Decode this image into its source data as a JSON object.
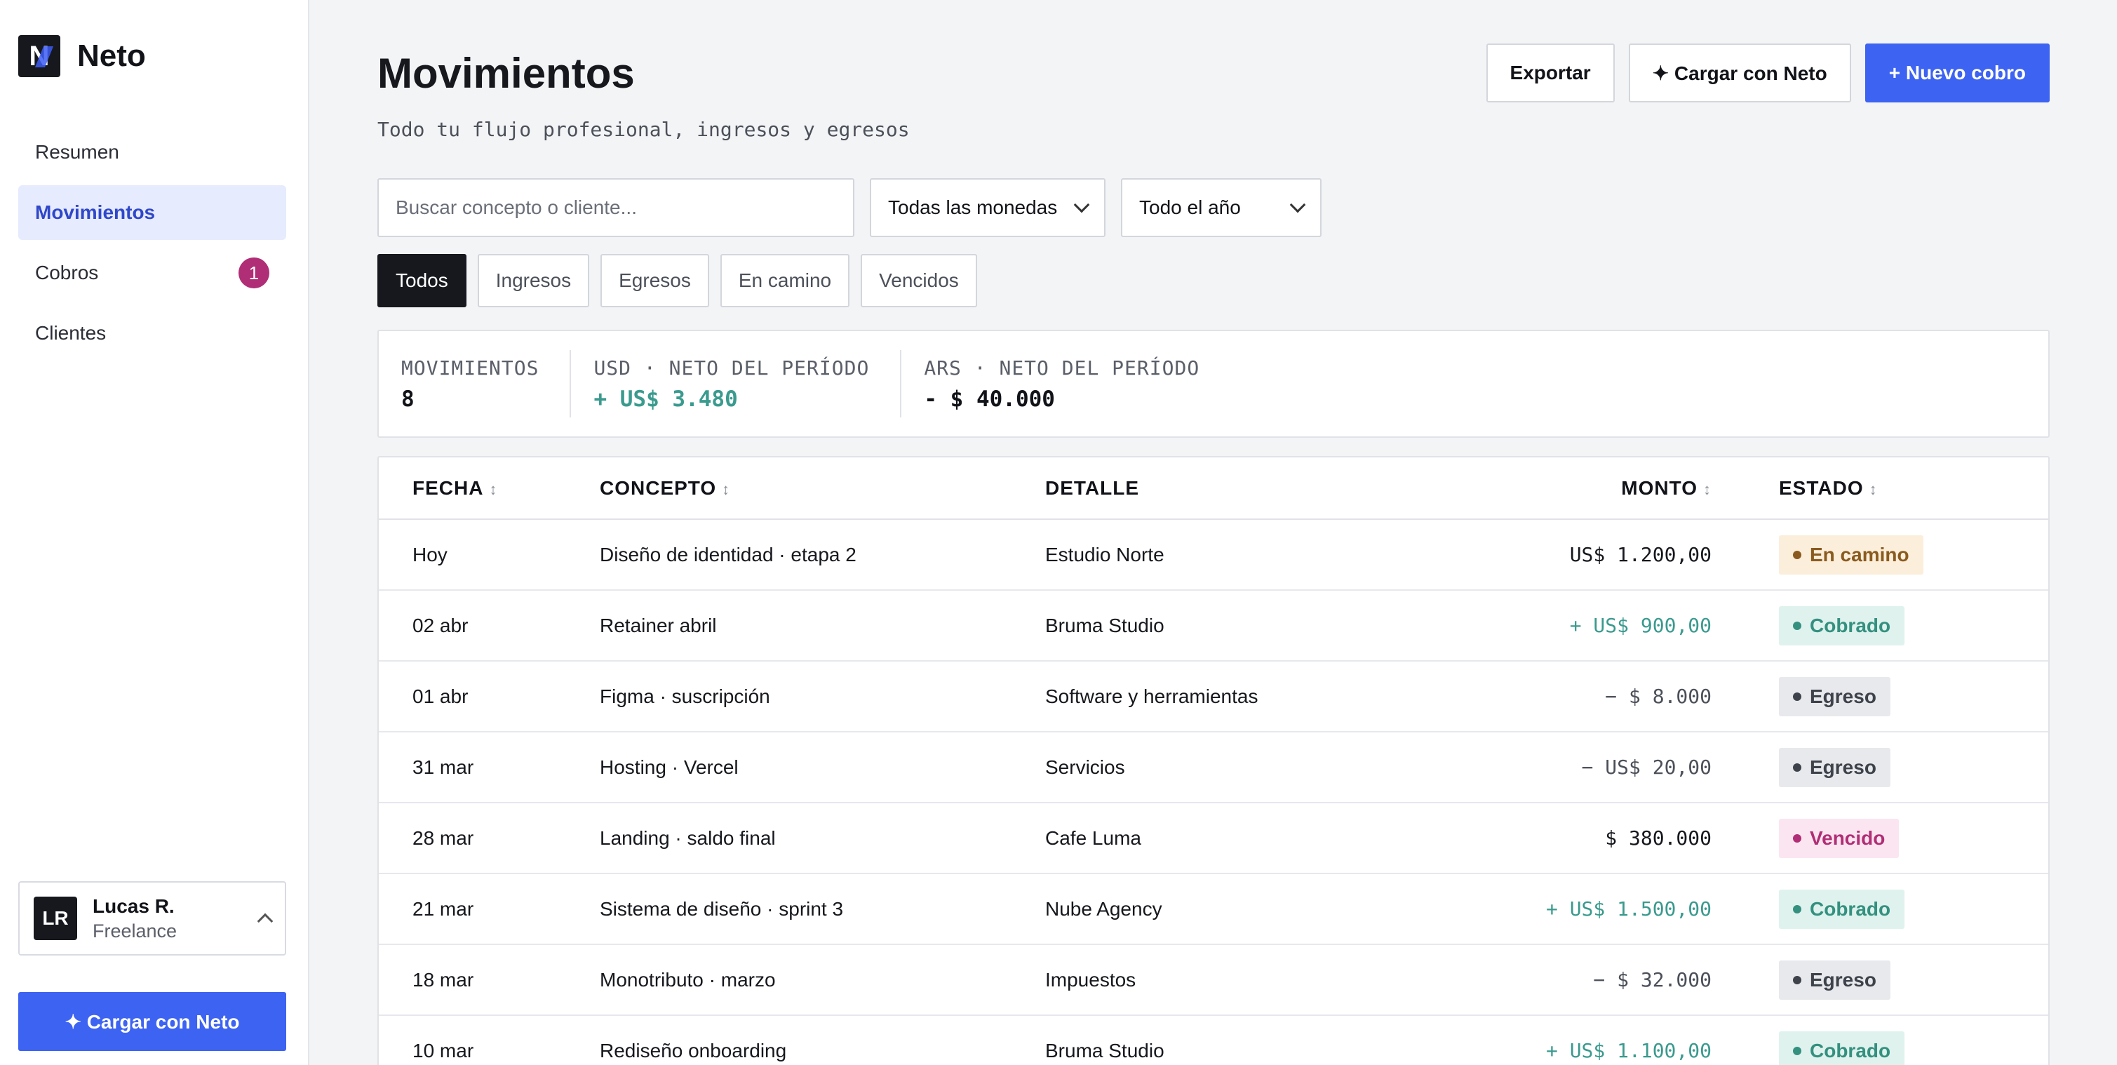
{
  "app": {
    "name": "Neto",
    "logo_letter": "N"
  },
  "sidebar": {
    "items": [
      {
        "label": "Resumen"
      },
      {
        "label": "Movimientos"
      },
      {
        "label": "Cobros",
        "badge": "1"
      },
      {
        "label": "Clientes"
      }
    ],
    "user": {
      "initials": "LR",
      "name": "Lucas R.",
      "role": "Freelance"
    },
    "cta_label": "✦ Cargar con Neto"
  },
  "header": {
    "title": "Movimientos",
    "subtitle": "Todo tu flujo profesional, ingresos y egresos",
    "export_label": "Exportar",
    "ai_label": "✦ Cargar con Neto",
    "new_label": "+ Nuevo cobro"
  },
  "filters": {
    "search_placeholder": "Buscar concepto o cliente...",
    "currency": "Todas las monedas",
    "period": "Todo el año"
  },
  "tabs": [
    "Todos",
    "Ingresos",
    "Egresos",
    "En camino",
    "Vencidos"
  ],
  "summary": [
    {
      "label": "MOVIMIENTOS",
      "value": "8"
    },
    {
      "label": "USD · NETO DEL PERÍODO",
      "value": "+ US$ 3.480"
    },
    {
      "label": "ARS · NETO DEL PERÍODO",
      "value": "- $ 40.000"
    }
  ],
  "table": {
    "columns": [
      "FECHA",
      "CONCEPTO",
      "DETALLE",
      "MONTO",
      "ESTADO"
    ],
    "sort_icon": "↕",
    "rows": [
      {
        "fecha": "Hoy",
        "concepto": "Diseño de identidad · etapa 2",
        "detalle": "Estudio Norte",
        "monto": "US$ 1.200,00",
        "estado": "En camino"
      },
      {
        "fecha": "02 abr",
        "concepto": "Retainer abril",
        "detalle": "Bruma Studio",
        "monto": "+ US$ 900,00",
        "estado": "Cobrado"
      },
      {
        "fecha": "01 abr",
        "concepto": "Figma · suscripción",
        "detalle": "Software y herramientas",
        "monto": "− $ 8.000",
        "estado": "Egreso"
      },
      {
        "fecha": "31 mar",
        "concepto": "Hosting · Vercel",
        "detalle": "Servicios",
        "monto": "− US$ 20,00",
        "estado": "Egreso"
      },
      {
        "fecha": "28 mar",
        "concepto": "Landing · saldo final",
        "detalle": "Cafe Luma",
        "monto": "$ 380.000",
        "estado": "Vencido"
      },
      {
        "fecha": "21 mar",
        "concepto": "Sistema de diseño · sprint 3",
        "detalle": "Nube Agency",
        "monto": "+ US$ 1.500,00",
        "estado": "Cobrado"
      },
      {
        "fecha": "18 mar",
        "concepto": "Monotributo · marzo",
        "detalle": "Impuestos",
        "monto": "− $ 32.000",
        "estado": "Egreso"
      },
      {
        "fecha": "10 mar",
        "concepto": "Rediseño onboarding",
        "detalle": "Bruma Studio",
        "monto": "+ US$ 1.100,00",
        "estado": "Cobrado"
      }
    ]
  },
  "colors": {
    "accent": "#3d63f2",
    "positive": "#3a9a8e",
    "overdue": "#b02e76",
    "in_transit": "#8a5a1e",
    "expense": "#3e424a"
  }
}
